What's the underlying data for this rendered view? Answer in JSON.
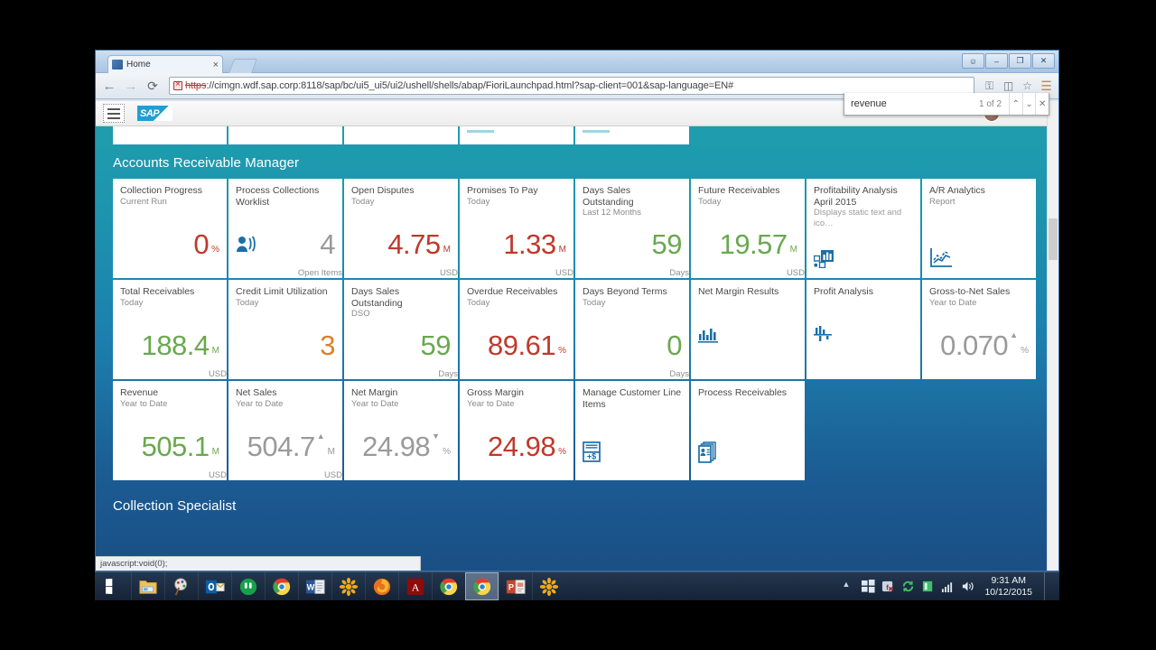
{
  "browser": {
    "tab_title": "Home",
    "tab_close": "×",
    "url_scheme": "https",
    "url_rest": "://cimgn.wdf.sap.corp:8118/sap/bc/ui5_ui5/ui2/ushell/shells/abap/FioriLaunchpad.html?sap-client=001&sap-language=EN#",
    "back_icon": "←",
    "forward_icon": "→",
    "reload_icon": "⟳",
    "win_minimize": "–",
    "win_maximize": "❐",
    "win_close": "✕",
    "win_user": "☺",
    "toolbar_icons": [
      "key-icon",
      "extension-icon",
      "bookmark-star-icon",
      "chrome-menu-icon"
    ],
    "status_text": "javascript:void(0);"
  },
  "find_bar": {
    "query": "revenue",
    "placeholder": "Find",
    "count": "1 of 2",
    "prev_icon": "⌃",
    "next_icon": "⌄",
    "close_icon": "✕"
  },
  "shell": {
    "menu_icon": "hamburger-icon",
    "logo_text": "SAP"
  },
  "groups": [
    {
      "title": "Accounts Receivable Manager",
      "rows": [
        [
          {
            "title": "Collection Progress",
            "sub": "Current Run",
            "value": "0",
            "unit": "%",
            "color": "v-red",
            "footer": ""
          },
          {
            "title": "Process Collections",
            "title2": "Worklist",
            "sub": "",
            "value": "4",
            "unit": "",
            "color": "v-grey",
            "footer": "Open Items",
            "icon": "contact-call-icon"
          },
          {
            "title": "Open Disputes",
            "sub": "Today",
            "value": "4.75",
            "unit": "M",
            "color": "v-red",
            "footer": "USD"
          },
          {
            "title": "Promises To Pay",
            "sub": "Today",
            "value": "1.33",
            "unit": "M",
            "color": "v-red",
            "footer": "USD"
          },
          {
            "title": "Days Sales",
            "title2": "Outstanding",
            "sub": "Last 12 Months",
            "value": "59",
            "unit": "",
            "color": "v-green",
            "footer": "Days"
          },
          {
            "title": "Future Receivables",
            "sub": "Today",
            "value": "19.57",
            "unit": "M",
            "color": "v-green",
            "footer": "USD"
          },
          {
            "title": "Profitability Analysis",
            "title2": "April 2015",
            "sub": "Displays static text and ico…",
            "value": "",
            "unit": "",
            "color": "",
            "footer": "",
            "icon": "bar-chart-tile-icon"
          },
          {
            "title": "A/R Analytics",
            "sub": "Report",
            "value": "",
            "unit": "",
            "color": "",
            "footer": "",
            "icon": "line-chart-icon"
          }
        ],
        [
          {
            "title": "Total Receivables",
            "sub": "Today",
            "value": "188.4",
            "unit": "M",
            "color": "v-green",
            "footer": "USD"
          },
          {
            "title": "Credit Limit Utilization",
            "sub": "Today",
            "value": "3",
            "unit": "",
            "color": "v-orange",
            "footer": ""
          },
          {
            "title": "Days Sales",
            "title2": "Outstanding",
            "sub": "DSO",
            "value": "59",
            "unit": "",
            "color": "v-green",
            "footer": "Days"
          },
          {
            "title": "Overdue Receivables",
            "sub": "Today",
            "value": "89.61",
            "unit": "%",
            "color": "v-red",
            "footer": ""
          },
          {
            "title": "Days Beyond Terms",
            "sub": "Today",
            "value": "0",
            "unit": "",
            "color": "v-green",
            "footer": "Days"
          },
          {
            "title": "Net Margin Results",
            "sub": "",
            "value": "",
            "unit": "",
            "color": "",
            "footer": "",
            "icon": "column-chart-icon"
          },
          {
            "title": "Profit Analysis",
            "sub": "",
            "value": "",
            "unit": "",
            "color": "",
            "footer": "",
            "icon": "scatter-chart-icon"
          },
          {
            "title": "Gross-to-Net Sales",
            "sub": "Year to Date",
            "value": "0.070",
            "unit": "%",
            "color": "v-grey",
            "footer": "",
            "arrow": "▲"
          }
        ],
        [
          {
            "title": "Revenue",
            "sub": "Year to Date",
            "value": "505.1",
            "unit": "M",
            "color": "v-green",
            "footer": "USD"
          },
          {
            "title": "Net Sales",
            "sub": "Year to Date",
            "value": "504.7",
            "unit": "M",
            "color": "v-grey",
            "footer": "USD",
            "arrow": "▲"
          },
          {
            "title": "Net Margin",
            "sub": "Year to Date",
            "value": "24.98",
            "unit": "%",
            "color": "v-grey",
            "footer": "",
            "arrow": "▼"
          },
          {
            "title": "Gross Margin",
            "sub": "Year to Date",
            "value": "24.98",
            "unit": "%",
            "color": "v-red",
            "footer": ""
          },
          {
            "title": "Manage Customer Line",
            "title2": "Items",
            "sub": "",
            "value": "",
            "unit": "",
            "color": "",
            "footer": "",
            "icon": "invoice-plus-icon"
          },
          {
            "title": "Process Receivables",
            "sub": "",
            "value": "",
            "unit": "",
            "color": "",
            "footer": "",
            "icon": "customer-document-icon"
          }
        ]
      ]
    },
    {
      "title": "Collection Specialist",
      "rows": []
    }
  ],
  "taskbar": {
    "start_label": "windows-start",
    "items": [
      "file-explorer-icon",
      "paint-icon",
      "outlook-icon",
      "greenshot-icon",
      "chrome-icon",
      "word-icon",
      "gimp-icon",
      "firefox-icon",
      "acrobat-icon",
      "chrome-icon-2",
      "chrome-icon-3",
      "powerpoint-icon",
      "gimp-icon-2"
    ],
    "tray": [
      "show-hidden-icons",
      "action-center-icon",
      "flash-icon",
      "sync-icon",
      "sap-icon",
      "network-icon",
      "volume-icon"
    ],
    "time": "9:31 AM",
    "date": "10/12/2015"
  }
}
